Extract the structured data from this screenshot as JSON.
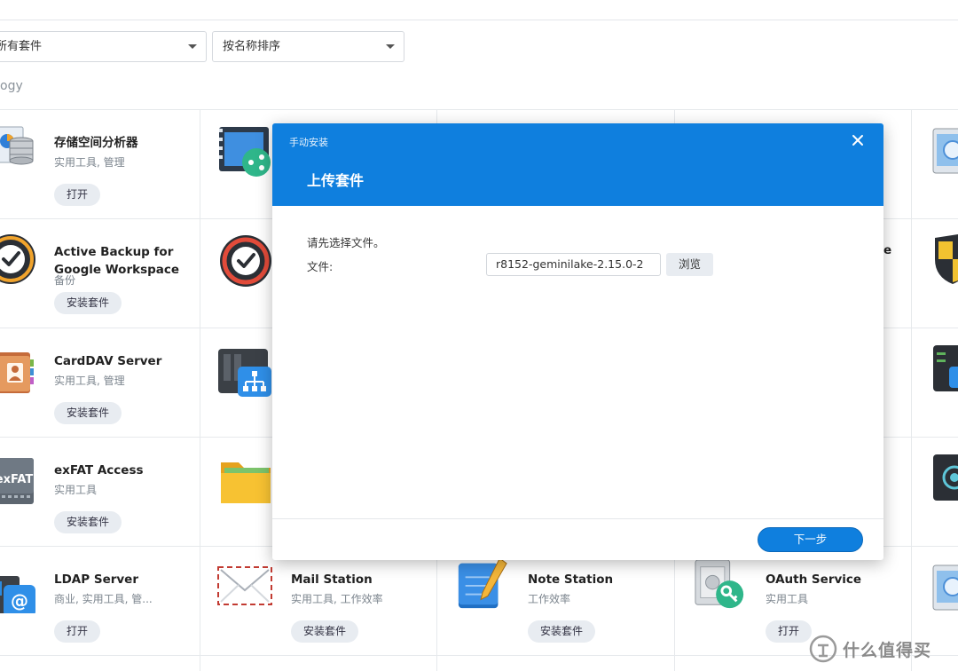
{
  "toolbar": {
    "filter_value": "所有套件",
    "sort_value": "按名称排序"
  },
  "section": {
    "label": "ogy"
  },
  "packages": [
    {
      "name": "存储空间分析器",
      "category": "实用工具, 管理",
      "action": "打开"
    },
    {
      "name": "Active Backup for\nGoogle Workspace",
      "category": "备份",
      "action": "安装套件"
    },
    {
      "name": "CardDAV Server",
      "category": "实用工具, 管理",
      "action": "安装套件"
    },
    {
      "name": "exFAT Access",
      "category": "实用工具",
      "action": "安装套件"
    },
    {
      "name": "LDAP Server",
      "category": "商业, 实用工具, 管...",
      "action": "打开"
    },
    {
      "name": "Mail Station",
      "category": "实用工具, 工作效率",
      "action": "安装套件"
    },
    {
      "name": "Note Station",
      "category": "工作效率",
      "action": "安装套件"
    },
    {
      "name": "OAuth Service",
      "category": "实用工具",
      "action": "打开"
    }
  ],
  "partial": {
    "name_fragment": "e"
  },
  "icons": {
    "storage_analyzer": "storage-analyzer-icon",
    "active_backup": "active-backup-icon",
    "carddav": "carddav-icon",
    "exfat": "exfat-icon",
    "ldap": "ldap-icon",
    "video_station": "video-station-icon",
    "active_backup_business": "active-backup-business-icon",
    "network_hub": "network-hub-icon",
    "file_station": "folder-icon",
    "mail_station": "mail-icon",
    "note_station": "note-icon",
    "oauth": "oauth-icon",
    "exfat_label": "exFAT"
  },
  "modal": {
    "subtitle": "手动安装",
    "title": "上传套件",
    "prompt": "请先选择文件。",
    "file_label": "文件:",
    "file_value": "r8152-geminilake-2.15.0-2",
    "browse_label": "浏览",
    "next_label": "下一步"
  },
  "watermark": {
    "text": "什么值得买"
  },
  "colors": {
    "accent": "#0f7fde",
    "button_bg": "#e8ecf1",
    "divider": "#e6e9ec"
  }
}
